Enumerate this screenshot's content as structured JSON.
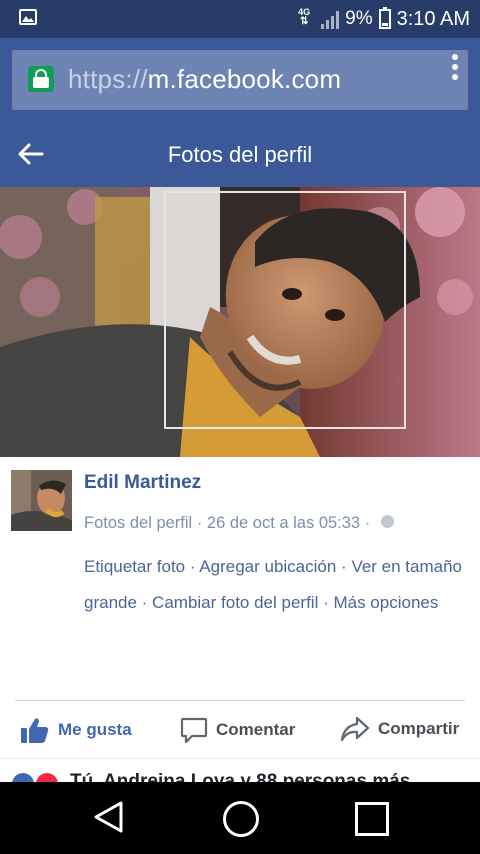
{
  "status_bar": {
    "network": "4G",
    "battery_percent": "9%",
    "time": "3:10 AM",
    "battery_level": 0.09
  },
  "browser": {
    "url_scheme": "https://",
    "url_host": "m.facebook.com",
    "secure_color": "#0f9d58"
  },
  "header": {
    "title": "Fotos del perfil"
  },
  "post": {
    "author": "Edil Martinez",
    "album": "Fotos del perfil",
    "date": "26 de oct a las 05:33",
    "actions": [
      "Etiquetar foto",
      "Agregar ubicación",
      "Ver en tamaño grande",
      "Cambiar foto del perfil",
      "Más opciones"
    ]
  },
  "action_bar": {
    "like_label": "Me gusta",
    "comment_label": "Comentar",
    "share_label": "Compartir"
  },
  "reactions": {
    "text": "Tú, Andreina Loya y 88 personas más"
  },
  "colors": {
    "brand": "#3b5998",
    "link": "#4267b2"
  }
}
